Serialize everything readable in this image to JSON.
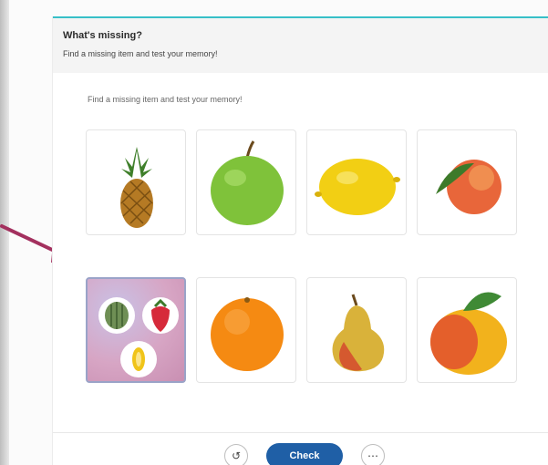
{
  "header": {
    "title": "What's missing?",
    "subtitle": "Find a missing item and test your memory!"
  },
  "instructions": "Find a missing item and test your memory!",
  "grid": {
    "row1": [
      {
        "item": "pineapple"
      },
      {
        "item": "green-apple"
      },
      {
        "item": "lemon"
      },
      {
        "item": "peach"
      }
    ],
    "row2": [
      {
        "item": "mystery-tile",
        "hint_items": [
          "watermelon",
          "strawberry",
          "banana"
        ]
      },
      {
        "item": "orange"
      },
      {
        "item": "pear"
      },
      {
        "item": "mango"
      }
    ]
  },
  "footer": {
    "reset_icon": "↺",
    "check_label": "Check",
    "more_icon": "⋯"
  },
  "colors": {
    "accent": "#37c0c8",
    "check_button": "#1f5fa6",
    "arrow": "#a3305e"
  }
}
